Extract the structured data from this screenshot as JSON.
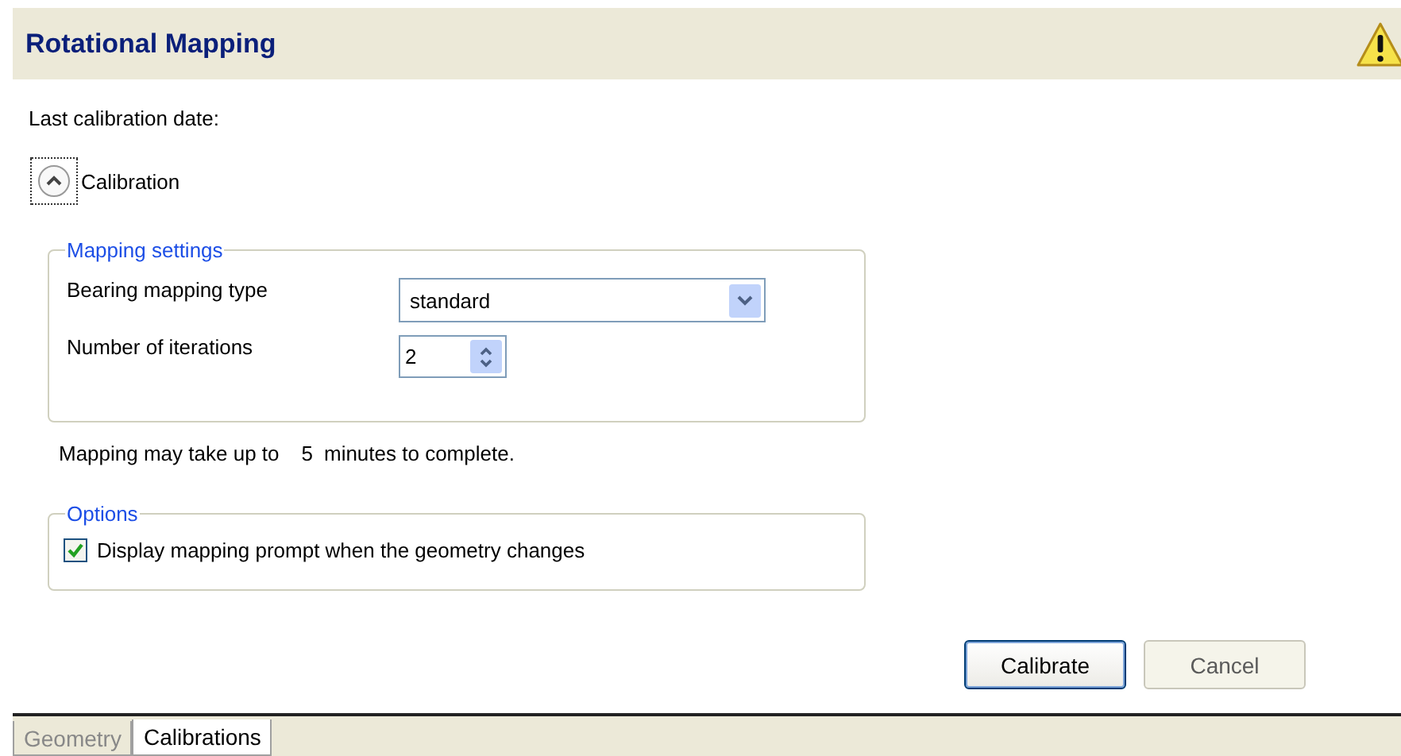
{
  "header": {
    "title": "Rotational Mapping"
  },
  "last_calibration": {
    "label": "Last calibration date:"
  },
  "expander": {
    "label": "Calibration",
    "expanded": true
  },
  "mapping_settings": {
    "legend": "Mapping settings",
    "bearing_type": {
      "label": "Bearing mapping type",
      "value": "standard"
    },
    "iterations": {
      "label": "Number of iterations",
      "value": "2"
    }
  },
  "duration": {
    "before": "Mapping may take up to",
    "minutes": "5",
    "after": "minutes to complete."
  },
  "options": {
    "legend": "Options",
    "checkbox": {
      "label": "Display mapping prompt when the geometry changes",
      "checked": true
    }
  },
  "buttons": [
    {
      "label": "Calibrate",
      "disabled": false
    },
    {
      "label": "Cancel",
      "disabled": true
    }
  ],
  "tabs": [
    {
      "label": "Geometry",
      "selected": false
    },
    {
      "label": "Calibrations",
      "selected": true
    }
  ]
}
